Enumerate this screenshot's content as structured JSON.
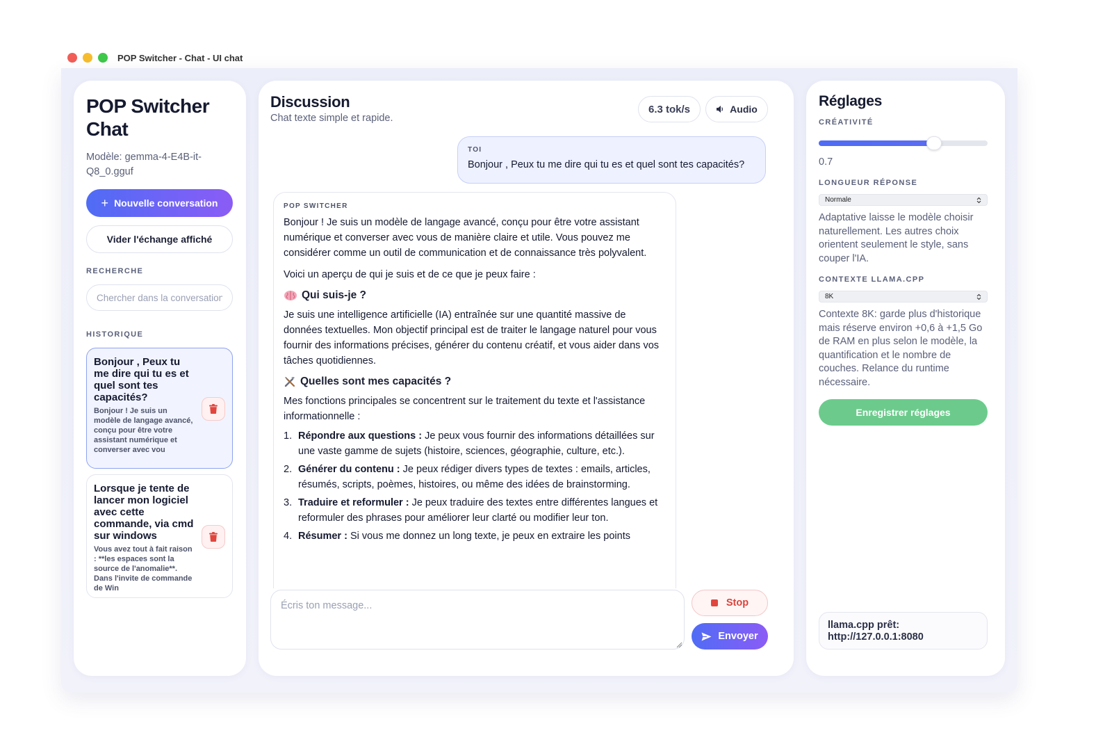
{
  "window": {
    "title": "POP Switcher - Chat - UI chat"
  },
  "sidebar": {
    "app_title": "POP Switcher Chat",
    "model_label": "Modèle: gemma-4-E4B-it-Q8_0.gguf",
    "new_conversation": "Nouvelle conversation",
    "clear_exchange": "Vider l'échange affiché",
    "search_label": "RECHERCHE",
    "search_placeholder": "Chercher dans la conversation",
    "history_label": "HISTORIQUE",
    "history": [
      {
        "title": "Bonjour , Peux tu me dire qui tu es et quel sont tes capacités?",
        "preview": "Bonjour ! Je suis un modèle de langage avancé, conçu pour être votre assistant numérique et converser avec vou"
      },
      {
        "title": "Lorsque je tente de lancer mon logiciel avec cette commande, via cmd sur windows",
        "preview": "Vous avez tout à fait raison : **les espaces sont la source de l'anomalie**. Dans l'invite de commande de Win"
      }
    ]
  },
  "chat": {
    "title": "Discussion",
    "subtitle": "Chat texte simple et rapide.",
    "tok_rate": "6.3 tok/s",
    "audio_label": "Audio",
    "user_label": "TOI",
    "user_message": "Bonjour , Peux tu me dire qui tu es et quel sont tes capacités?",
    "bot_label": "POP SWITCHER",
    "bot": {
      "intro": "Bonjour ! Je suis un modèle de langage avancé, conçu pour être votre assistant numérique et converser avec vous de manière claire et utile. Vous pouvez me considérer comme un outil de communication et de connaissance très polyvalent.",
      "overview": "Voici un aperçu de qui je suis et de ce que je peux faire :",
      "h1": "Qui suis-je ?",
      "p1": "Je suis une intelligence artificielle (IA) entraînée sur une quantité massive de données textuelles. Mon objectif principal est de traiter le langage naturel pour vous fournir des informations précises, générer du contenu créatif, et vous aider dans vos tâches quotidiennes.",
      "h2": "Quelles sont mes capacités ?",
      "p2": "Mes fonctions principales se concentrent sur le traitement du texte et l'assistance informationnelle :",
      "list": [
        {
          "num": "1.",
          "bold": "Répondre aux questions :",
          "text": " Je peux vous fournir des informations détaillées sur une vaste gamme de sujets (histoire, sciences, géographie, culture, etc.)."
        },
        {
          "num": "2.",
          "bold": "Générer du contenu :",
          "text": " Je peux rédiger divers types de textes : emails, articles, résumés, scripts, poèmes, histoires, ou même des idées de brainstorming."
        },
        {
          "num": "3.",
          "bold": "Traduire et reformuler :",
          "text": " Je peux traduire des textes entre différentes langues et reformuler des phrases pour améliorer leur clarté ou modifier leur ton."
        },
        {
          "num": "4.",
          "bold": "Résumer :",
          "text": " Si vous me donnez un long texte, je peux en extraire les points"
        }
      ]
    },
    "composer_placeholder": "Écris ton message...",
    "stop_label": "Stop",
    "send_label": "Envoyer"
  },
  "settings": {
    "title": "Réglages",
    "creativity_label": "CRÉATIVITÉ",
    "creativity_value": "0.7",
    "creativity_fraction": 0.7,
    "length_label": "LONGUEUR RÉPONSE",
    "length_value": "Normale",
    "length_help": "Adaptative laisse le modèle choisir naturellement. Les autres choix orientent seulement le style, sans couper l'IA.",
    "context_label": "CONTEXTE LLAMA.CPP",
    "context_value": "8K",
    "context_help": "Contexte 8K: garde plus d'historique mais réserve environ +0,6 à +1,5 Go de RAM en plus selon le modèle, la quantification et le nombre de couches. Relance du runtime nécessaire.",
    "save_label": "Enregistrer réglages",
    "status": "llama.cpp prêt: http://127.0.0.1:8080"
  },
  "colors": {
    "accent_start": "#4f6cf5",
    "accent_end": "#8b5cf6",
    "save_green": "#6ccb8c",
    "stop_red": "#d9443c"
  }
}
